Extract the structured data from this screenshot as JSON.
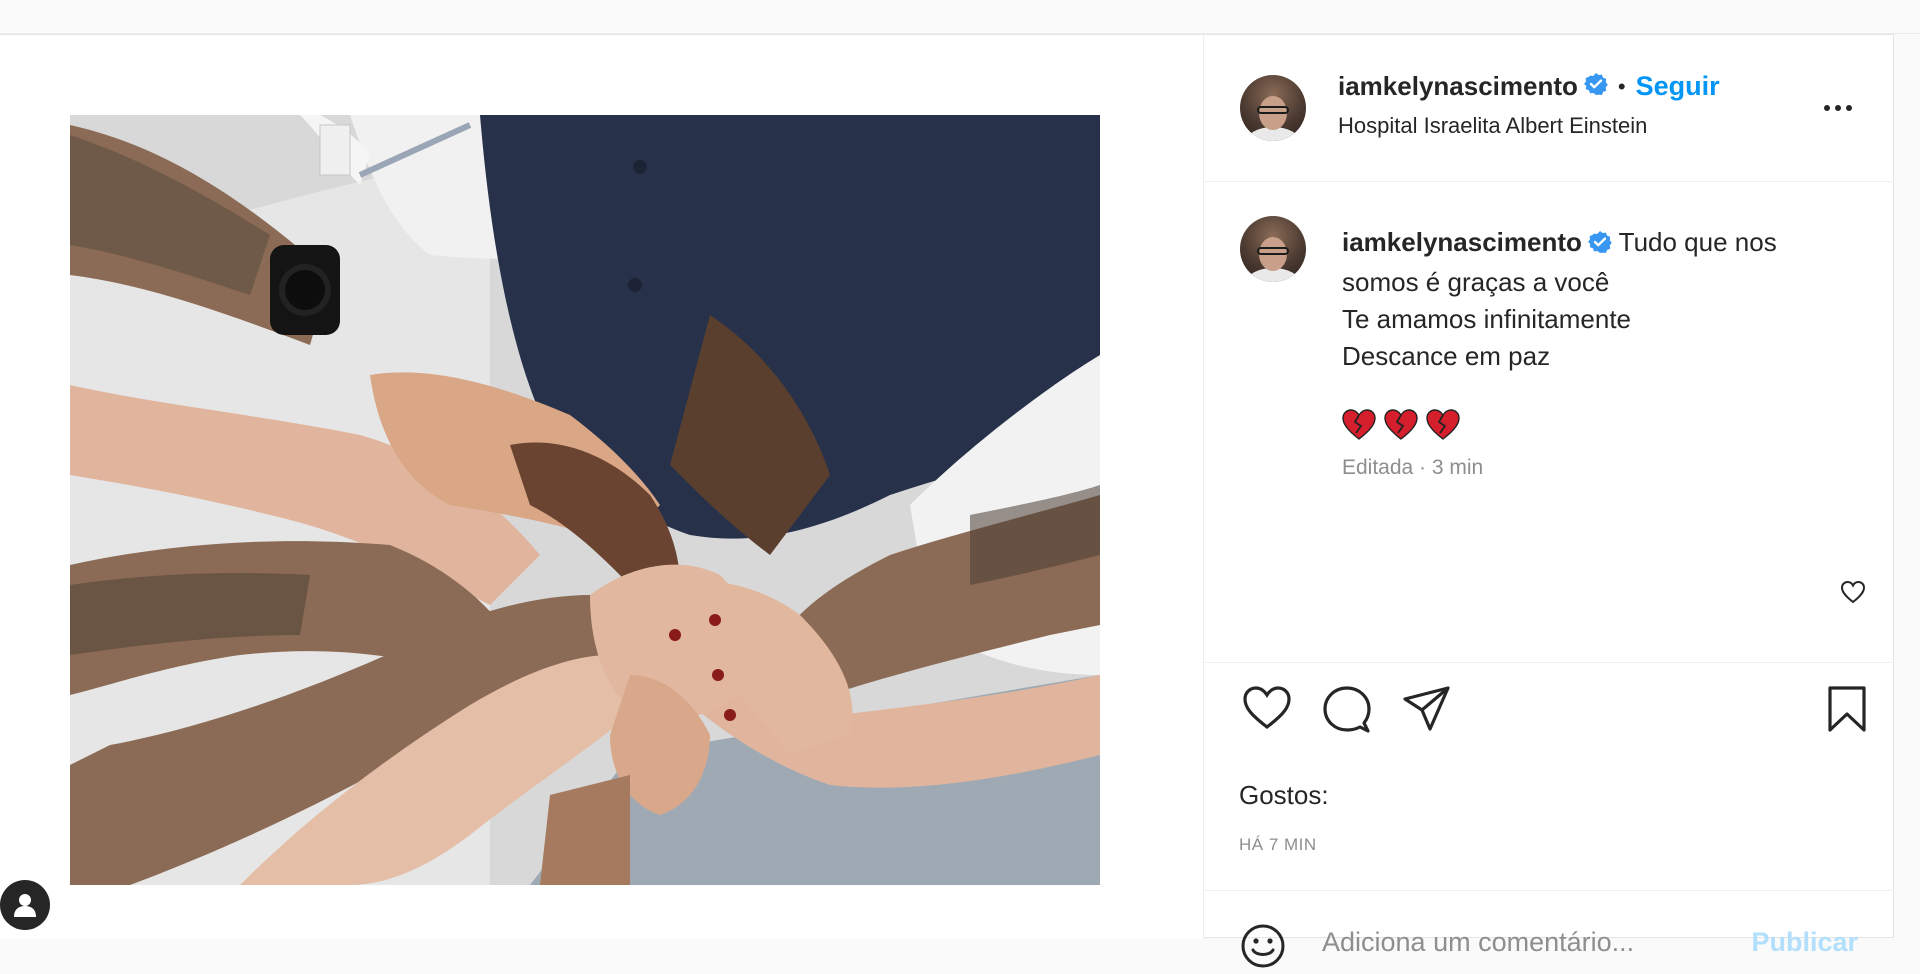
{
  "post": {
    "username": "iamkelynascimento",
    "separator": "•",
    "follow_label": "Seguir",
    "location": "Hospital Israelita Albert Einstein",
    "caption_lines": [
      "Tudo que nos",
      "somos é graças a você",
      "Te amamos infinitamente",
      "Descance em paz"
    ],
    "caption_meta": "Editada · 3 min",
    "likes_label": "Gostos:",
    "time_ago": "HÁ 7 MIN",
    "comment_placeholder": "Adiciona um comentário...",
    "publish_label": "Publicar"
  },
  "icons": {
    "header": [
      "verified-icon",
      "more-options-icon"
    ],
    "caption": [
      "broken-heart-icon",
      "broken-heart-icon",
      "broken-heart-icon",
      "comment-like-icon"
    ],
    "actions": [
      "like-icon",
      "comment-icon",
      "share-icon",
      "save-icon"
    ],
    "composer": [
      "emoji-icon"
    ],
    "floating": [
      "profile-icon"
    ]
  },
  "colors": {
    "accent": "#0095f6",
    "publish_disabled": "#b2dffc",
    "muted": "#8e8e8e",
    "text": "#262626",
    "heart": "#d61f2c"
  }
}
